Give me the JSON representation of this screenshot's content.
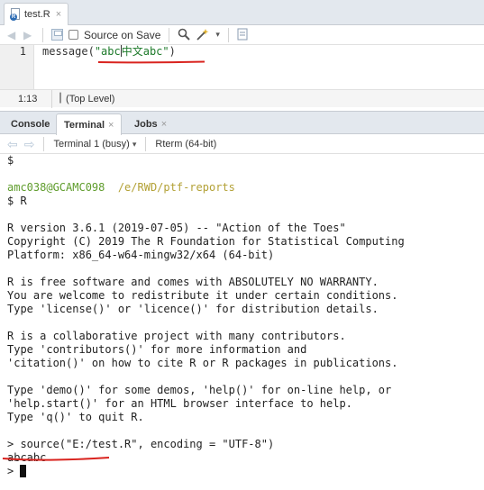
{
  "editor": {
    "tab": {
      "label": "test.R",
      "close": "×"
    },
    "toolbar": {
      "source_on_save_label": "Source on Save"
    },
    "code": {
      "line_number": "1",
      "fn": "message",
      "open_paren": "(",
      "string_a": "\"abc",
      "string_cjk": "中文",
      "string_b": "abc\"",
      "close_paren": ")"
    },
    "status": {
      "position": "1:13",
      "scope": "(Top Level)"
    }
  },
  "console": {
    "tabs": [
      {
        "label": "Console",
        "close": ""
      },
      {
        "label": "Terminal",
        "close": "×"
      },
      {
        "label": "Jobs",
        "close": "×"
      }
    ],
    "toolbar": {
      "terminal_select": "Terminal 1 (busy)",
      "term_label": "Rterm (64-bit)"
    },
    "lines": [
      {
        "text": "$",
        "style": "plain"
      },
      {
        "text": "",
        "style": "plain"
      },
      {
        "user": "amc038@GCAMC098",
        "path": "/e/RWD/ptf-reports",
        "style": "prompt"
      },
      {
        "text": "$ R",
        "style": "plain"
      },
      {
        "text": "",
        "style": "plain"
      },
      {
        "text": "R version 3.6.1 (2019-07-05) -- \"Action of the Toes\"",
        "style": "plain"
      },
      {
        "text": "Copyright (C) 2019 The R Foundation for Statistical Computing",
        "style": "plain"
      },
      {
        "text": "Platform: x86_64-w64-mingw32/x64 (64-bit)",
        "style": "plain"
      },
      {
        "text": "",
        "style": "plain"
      },
      {
        "text": "R is free software and comes with ABSOLUTELY NO WARRANTY.",
        "style": "plain"
      },
      {
        "text": "You are welcome to redistribute it under certain conditions.",
        "style": "plain"
      },
      {
        "text": "Type 'license()' or 'licence()' for distribution details.",
        "style": "plain"
      },
      {
        "text": "",
        "style": "plain"
      },
      {
        "text": "R is a collaborative project with many contributors.",
        "style": "plain"
      },
      {
        "text": "Type 'contributors()' for more information and",
        "style": "plain"
      },
      {
        "text": "'citation()' on how to cite R or R packages in publications.",
        "style": "plain"
      },
      {
        "text": "",
        "style": "plain"
      },
      {
        "text": "Type 'demo()' for some demos, 'help()' for on-line help, or",
        "style": "plain"
      },
      {
        "text": "'help.start()' for an HTML browser interface to help.",
        "style": "plain"
      },
      {
        "text": "Type 'q()' to quit R.",
        "style": "plain"
      },
      {
        "text": "",
        "style": "plain"
      },
      {
        "text": "> source(\"E:/test.R\", encoding = \"UTF-8\")",
        "style": "plain"
      },
      {
        "text": "abcabc",
        "style": "plain"
      },
      {
        "text": "> ",
        "style": "cursor"
      }
    ]
  },
  "colors": {
    "annotation_red": "#d9231e",
    "string_green": "#1d7a2a",
    "prompt_green": "#5f9c2c",
    "prompt_yellow": "#b3a136"
  },
  "icons": [
    "r-file-icon",
    "back-arrow-icon",
    "forward-arrow-icon",
    "save-icon",
    "search-icon",
    "magic-wand-icon",
    "chevron-down-icon",
    "compile-report-icon"
  ]
}
